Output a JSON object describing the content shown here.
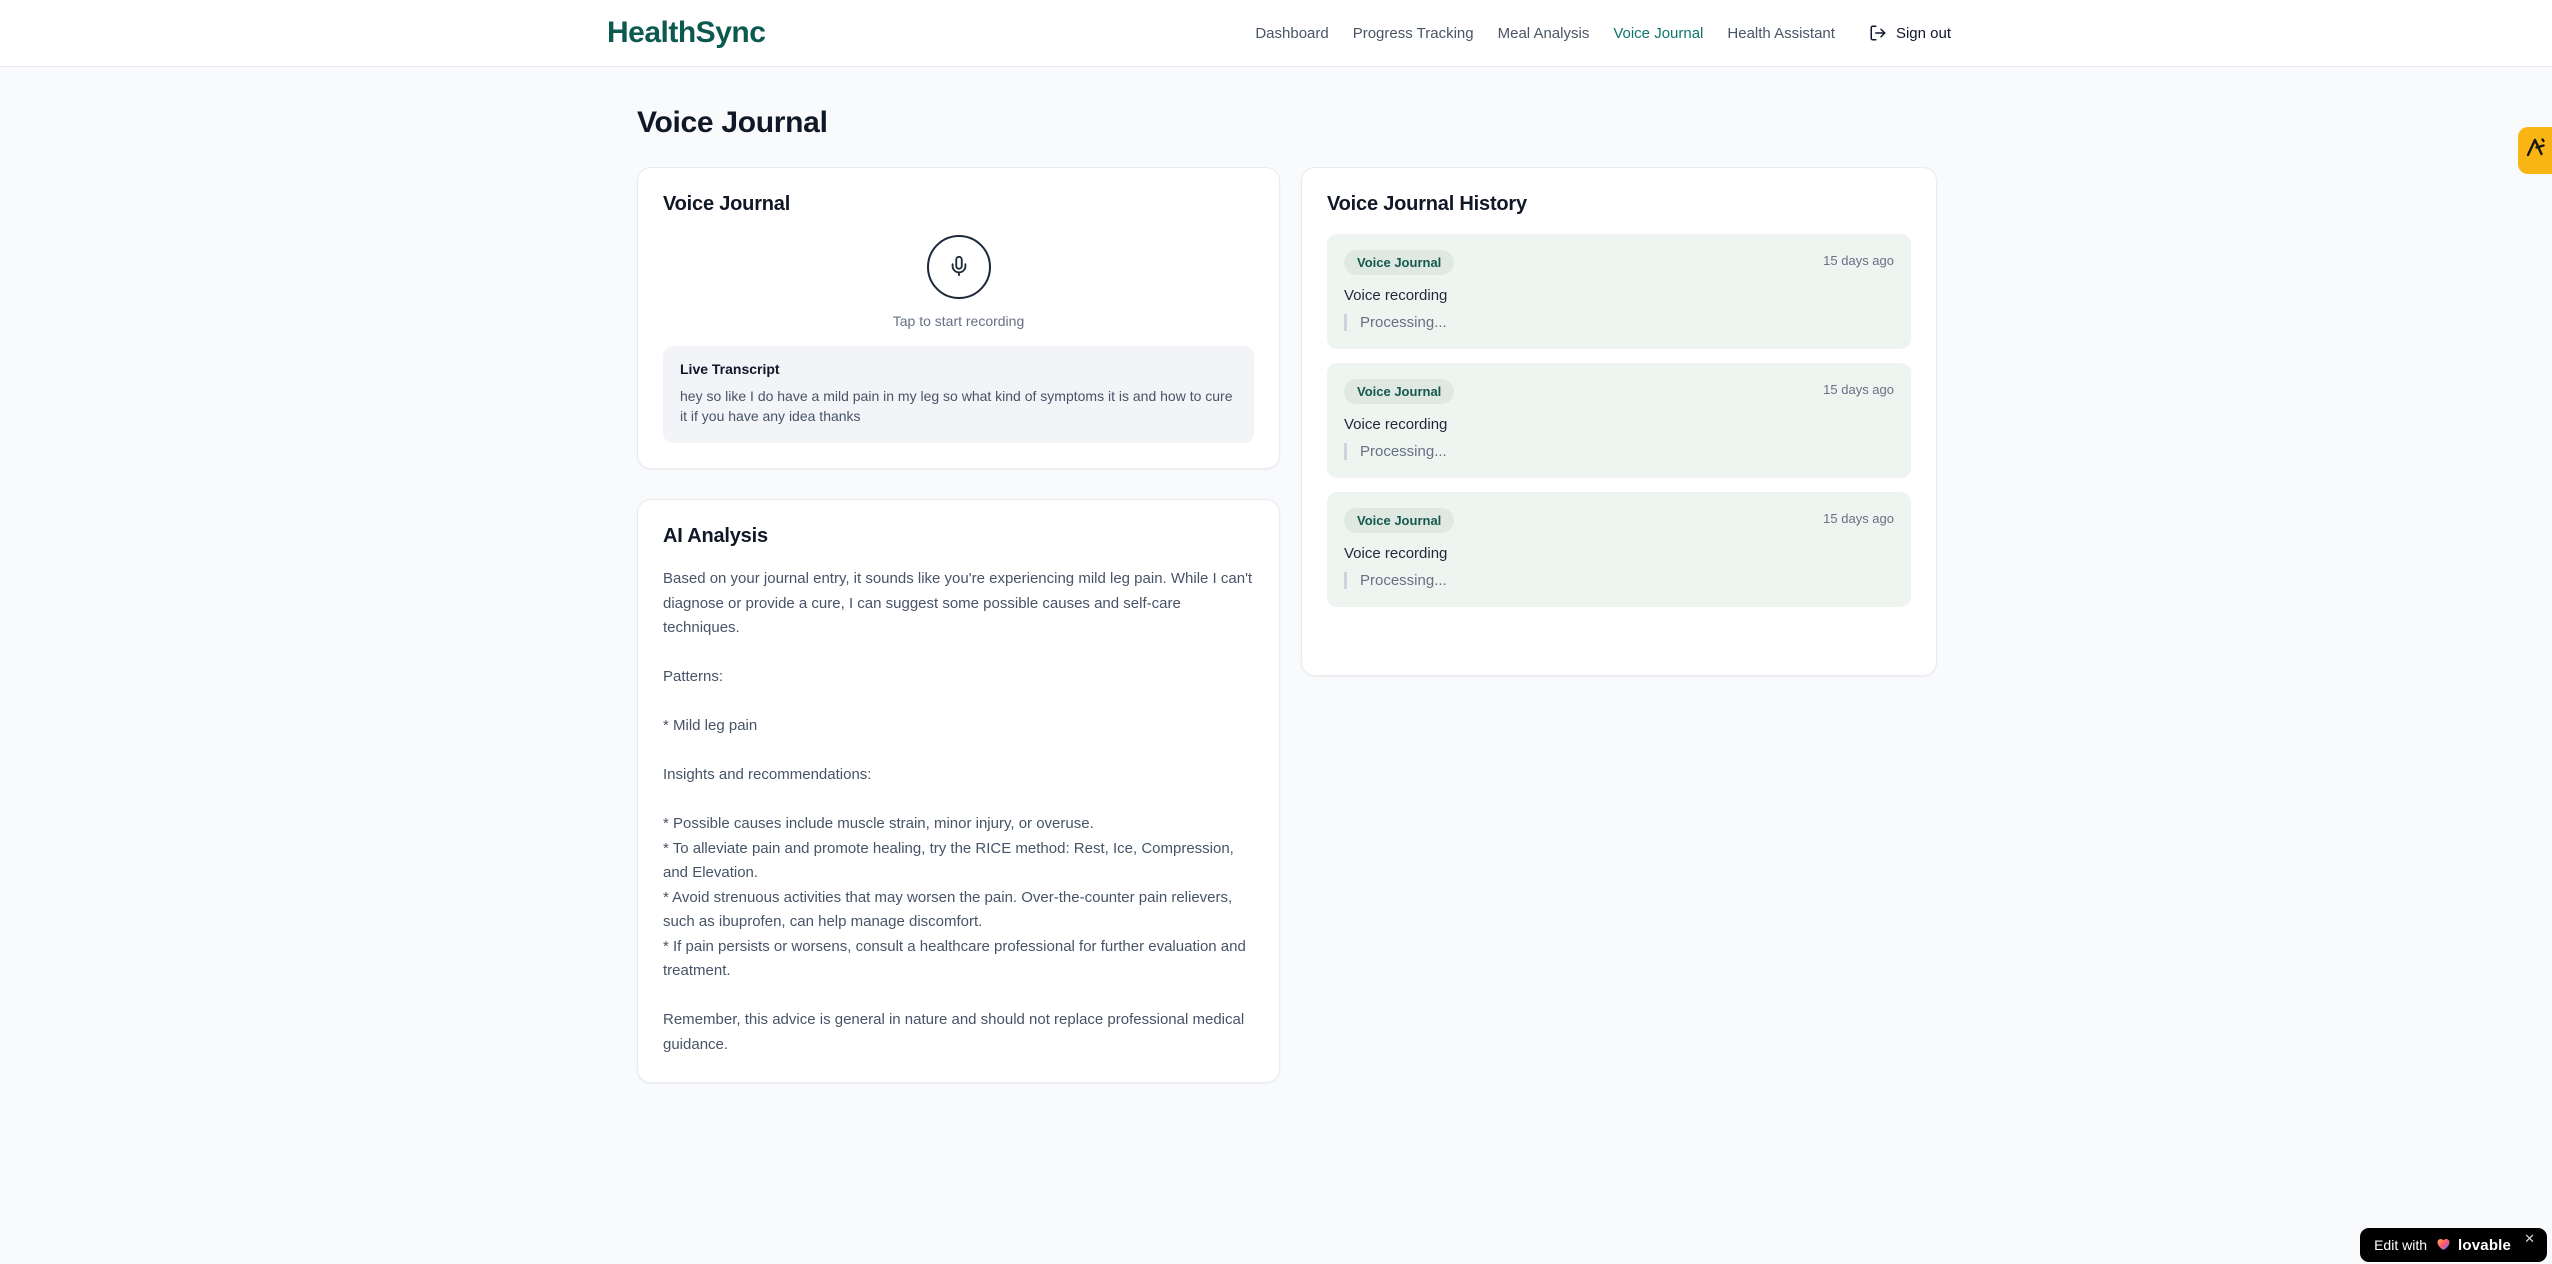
{
  "colors": {
    "brand_teal": "#0c5a4f",
    "nav_active_teal": "#0f766e",
    "history_entry_bg": "#eef5f0",
    "badge_pill_bg": "#dfe9e2",
    "badge_pill_text": "#15594e",
    "amber_badge_bg": "#f9b513",
    "edit_badge_bg": "#000000",
    "page_bg": "#f8fafc"
  },
  "header": {
    "brand": "HealthSync",
    "nav": [
      {
        "label": "Dashboard",
        "active": false
      },
      {
        "label": "Progress Tracking",
        "active": false
      },
      {
        "label": "Meal Analysis",
        "active": false
      },
      {
        "label": "Voice Journal",
        "active": true
      },
      {
        "label": "Health Assistant",
        "active": false
      }
    ],
    "sign_out": "Sign out"
  },
  "page": {
    "title": "Voice Journal"
  },
  "recorder": {
    "title": "Voice Journal",
    "tap_hint": "Tap to start recording",
    "transcript_heading": "Live Transcript",
    "transcript_text": "hey so like I do have a mild pain in my leg so what kind of symptoms it is and how to cure it if you have any idea thanks"
  },
  "analysis": {
    "title": "AI Analysis",
    "body": "Based on your journal entry, it sounds like you're experiencing mild leg pain. While I can't diagnose or provide a cure, I can suggest some possible causes and self-care techniques.\n\nPatterns:\n\n* Mild leg pain\n\nInsights and recommendations:\n\n* Possible causes include muscle strain, minor injury, or overuse.\n* To alleviate pain and promote healing, try the RICE method: Rest, Ice, Compression, and Elevation.\n* Avoid strenuous activities that may worsen the pain. Over-the-counter pain relievers, such as ibuprofen, can help manage discomfort.\n* If pain persists or worsens, consult a healthcare professional for further evaluation and treatment.\n\nRemember, this advice is general in nature and should not replace professional medical guidance."
  },
  "history": {
    "title": "Voice Journal History",
    "entries": [
      {
        "badge": "Voice Journal",
        "time": "15 days ago",
        "title": "Voice recording",
        "status": "Processing..."
      },
      {
        "badge": "Voice Journal",
        "time": "15 days ago",
        "title": "Voice recording",
        "status": "Processing..."
      },
      {
        "badge": "Voice Journal",
        "time": "15 days ago",
        "title": "Voice recording",
        "status": "Processing..."
      }
    ]
  },
  "icons": {
    "mic": "mic-icon",
    "logout": "log-out-icon",
    "heart": "heart-icon",
    "close": "close-icon",
    "peak": "peak-logo-icon"
  },
  "overlays": {
    "edit_with": "Edit with",
    "lovable": "lovable",
    "close": "✕"
  }
}
